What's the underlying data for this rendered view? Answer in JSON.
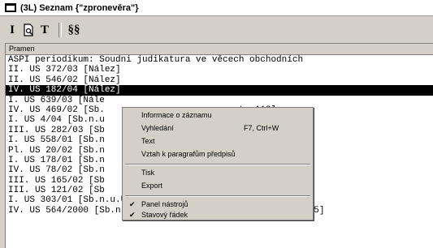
{
  "window": {
    "title": "(3L) Seznam {\"zpronevěra\"}"
  },
  "toolbar": {
    "b1": "I",
    "b2": "▢",
    "b3": "T",
    "b4": "§§"
  },
  "list": {
    "header": "Pramen",
    "rows": [
      "ASPI periodikum: Soudni judikatura ve věcech obchodních",
      "II. ÚS 372/03 [Nález]",
      "II. ÚS 546/02 [Nález]",
      "IV. ÚS 182/04 [Nález]",
      "I. ÚS 639/03 [Nále",
      "IV. ÚS 469/02 [Sb.                        str.113]",
      "I. ÚS 4/04 [Sb.n.u                        .405]",
      "III. ÚS 282/03 [Sb                        .23 str.343]",
      "I. ÚS 558/01 [Sb.n                        str.205]",
      "Pl. ÚS 20/02 [Sb.n                        2 str.477]",
      "I. ÚS 178/01 [Sb.n                        str.335]",
      "IV. ÚS 78/02 [Sb.n                        str.109]",
      "III. ÚS 165/02 [Sb                        8 str.415]",
      "III. ÚS 121/02 [Sb                        str.203]",
      "I. ÚS 303/01 [Sb.n.u.ÚS Svazek č.24 Nález č.156 str.149]",
      "IV. ÚS 564/2000 [Sb.n.u.ÚS Svazek č.24 Nález č.169 str.255]"
    ],
    "selected_index": 3
  },
  "context_menu": {
    "info": "Informace o záznamu",
    "search": "Vyhledání",
    "search_shortcut": "F7, Ctrl+W",
    "text": "Text",
    "paragraph": "Vztah k paragrafům předpisů",
    "print": "Tisk",
    "export": "Export",
    "toolbar": "Panel nástrojů",
    "statusbar": "Stavový řádek",
    "check": "✔"
  }
}
